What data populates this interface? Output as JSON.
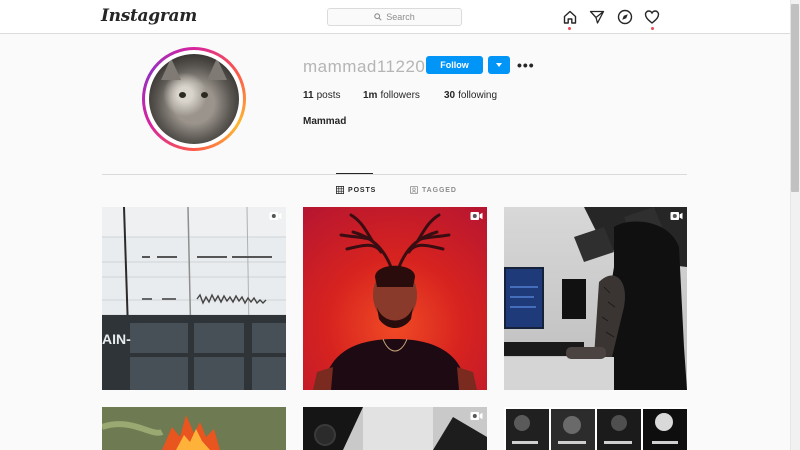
{
  "app": {
    "logo_text": "Instagram"
  },
  "nav": {
    "search_placeholder": "Search",
    "icons": [
      "home-icon",
      "direct-icon",
      "explore-icon",
      "activity-icon"
    ],
    "notification_dot_color": "#ed4956"
  },
  "profile": {
    "username": "mammad11220",
    "follow_label": "Follow",
    "options_label": "•••",
    "posts_count": "11",
    "posts_label": "posts",
    "followers_count": "1m",
    "followers_label": "followers",
    "following_count": "30",
    "following_label": "following",
    "full_name": "Mammad"
  },
  "tabs": {
    "posts": "POSTS",
    "tagged": "TAGGED"
  },
  "posts": [
    {
      "type": "video",
      "subject": "audio waveform screen"
    },
    {
      "type": "video",
      "subject": "man with antlers, red background"
    },
    {
      "type": "video",
      "subject": "hooded person at studio desk"
    },
    {
      "type": "image",
      "subject": "fire outdoors"
    },
    {
      "type": "video",
      "subject": "speaker and shapes"
    },
    {
      "type": "image",
      "subject": "album covers collage"
    }
  ],
  "colors": {
    "accent": "#0095f6",
    "text": "#262626",
    "muted": "#8e8e8e",
    "border": "#dbdbdb",
    "background": "#fafafa"
  }
}
